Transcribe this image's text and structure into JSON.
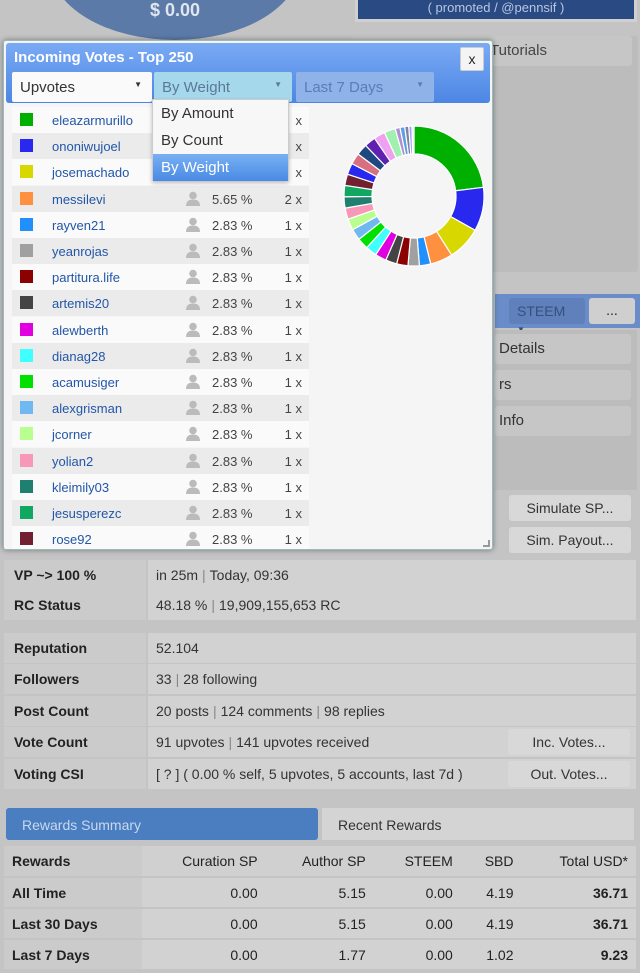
{
  "background": {
    "balance": "$ 0.00",
    "promo": "( promoted / @pennsif )",
    "tutorials": "Tutorials",
    "currency": "STEEM",
    "more": "...",
    "side_items": [
      "Details",
      "rs",
      "Info"
    ],
    "simulate_sp": "Simulate SP...",
    "sim_payout": "Sim. Payout...",
    "stats": [
      {
        "label": "VP ~> 100 %",
        "value": [
          "in 25m",
          "Today, 09:36"
        ]
      },
      {
        "label": "RC Status",
        "value": [
          "48.18 %",
          "19,909,155,653 RC"
        ]
      },
      {
        "label": "Reputation",
        "value": [
          "52.104"
        ]
      },
      {
        "label": "Followers",
        "value": [
          "33",
          "28 following"
        ]
      },
      {
        "label": "Post Count",
        "value": [
          "20 posts",
          "124 comments",
          "98 replies"
        ]
      },
      {
        "label": "Vote Count",
        "value": [
          "91 upvotes",
          "141 upvotes received"
        ],
        "button": "Inc. Votes..."
      },
      {
        "label": "Voting CSI",
        "value": [
          "[ ? ] ( 0.00 % self, 5 upvotes, 5 accounts, last 7d )"
        ],
        "button": "Out. Votes..."
      }
    ],
    "rewards": {
      "tabs": [
        "Rewards Summary",
        "Recent Rewards"
      ],
      "headers": [
        "Rewards",
        "Curation SP",
        "Author SP",
        "STEEM",
        "SBD",
        "Total USD*"
      ],
      "rows": [
        [
          "All Time",
          "0.00",
          "5.15",
          "0.00",
          "4.19",
          "36.71"
        ],
        [
          "Last 30 Days",
          "0.00",
          "5.15",
          "0.00",
          "4.19",
          "36.71"
        ],
        [
          "Last 7 Days",
          "0.00",
          "1.77",
          "0.00",
          "1.02",
          "9.23"
        ]
      ]
    }
  },
  "dialog": {
    "title": "Incoming Votes - Top 250",
    "close": "x",
    "type_select": "Upvotes",
    "sort_select": "By Weight",
    "period_select": "Last 7 Days",
    "sort_options": [
      "By Amount",
      "By Count",
      "By Weight"
    ],
    "sort_selected": "By Weight",
    "voters": [
      {
        "name": "eleazarmurillo",
        "color": "#00b000",
        "pct": "",
        "count": "x"
      },
      {
        "name": "ononiwujoel",
        "color": "#2828ee",
        "pct": "",
        "count": "x"
      },
      {
        "name": "josemachado",
        "color": "#d8d800",
        "pct": "",
        "count": "x"
      },
      {
        "name": "messilevi",
        "color": "#ff9040",
        "pct": "5.65 %",
        "count": "2 x"
      },
      {
        "name": "rayven21",
        "color": "#2090ff",
        "pct": "2.83 %",
        "count": "1 x"
      },
      {
        "name": "yeanrojas",
        "color": "#a0a0a0",
        "pct": "2.83 %",
        "count": "1 x"
      },
      {
        "name": "partitura.life",
        "color": "#8b0000",
        "pct": "2.83 %",
        "count": "1 x"
      },
      {
        "name": "artemis20",
        "color": "#444444",
        "pct": "2.83 %",
        "count": "1 x"
      },
      {
        "name": "alewberth",
        "color": "#e000e0",
        "pct": "2.83 %",
        "count": "1 x"
      },
      {
        "name": "dianag28",
        "color": "#40ffff",
        "pct": "2.83 %",
        "count": "1 x"
      },
      {
        "name": "acamusiger",
        "color": "#00e000",
        "pct": "2.83 %",
        "count": "1 x"
      },
      {
        "name": "alexgrisman",
        "color": "#70b8f0",
        "pct": "2.83 %",
        "count": "1 x"
      },
      {
        "name": "jcorner",
        "color": "#b8ff90",
        "pct": "2.83 %",
        "count": "1 x"
      },
      {
        "name": "yolian2",
        "color": "#f898b8",
        "pct": "2.83 %",
        "count": "1 x"
      },
      {
        "name": "kleimily03",
        "color": "#208070",
        "pct": "2.83 %",
        "count": "1 x"
      },
      {
        "name": "jesusperezc",
        "color": "#10a860",
        "pct": "2.83 %",
        "count": "1 x"
      },
      {
        "name": "rose92",
        "color": "#702030",
        "pct": "2.83 %",
        "count": "1 x"
      }
    ]
  },
  "chart_data": {
    "type": "pie",
    "values": [
      25,
      11,
      8.5,
      5.65,
      2.83,
      2.83,
      2.83,
      2.83,
      2.83,
      2.83,
      2.83,
      2.83,
      2.83,
      2.83,
      2.83,
      2.83,
      2.83,
      2.83,
      2.83,
      2.83,
      2.83,
      2.83,
      2.83,
      1.2,
      1.2,
      1.0,
      0.8,
      0.5
    ],
    "colors": [
      "#00b000",
      "#2828ee",
      "#d8d800",
      "#ff9040",
      "#2090ff",
      "#a0a0a0",
      "#8b0000",
      "#444444",
      "#e000e0",
      "#40ffff",
      "#00e000",
      "#70b8f0",
      "#b8ff90",
      "#f898b8",
      "#208070",
      "#10a860",
      "#702030",
      "#2828ee",
      "#d87080",
      "#204880",
      "#6020b0",
      "#f0a0f0",
      "#a0f0b0",
      "#b090d0",
      "#60a0e0",
      "#8080a0",
      "#a0a0ff",
      "#e0e0e0"
    ]
  }
}
